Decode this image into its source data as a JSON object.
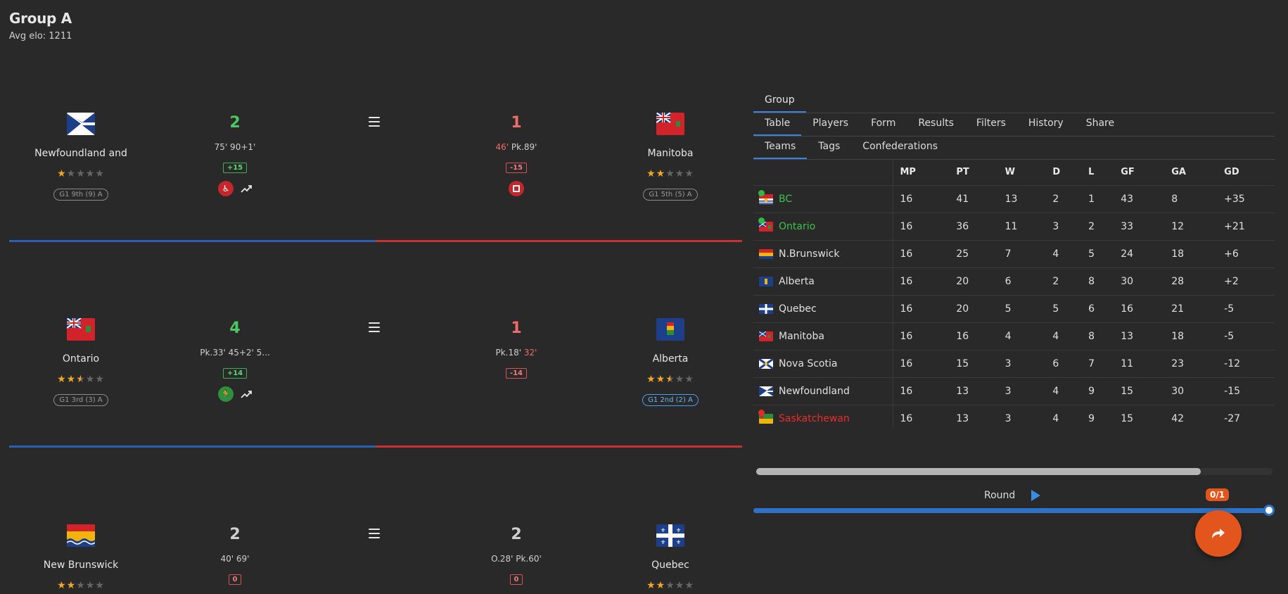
{
  "group": {
    "title": "Group A",
    "avg_elo": "Avg elo: 1211"
  },
  "matches": [
    {
      "home": {
        "name": "Newfoundland and",
        "stars": 1,
        "rank": "G1 9th (9) A"
      },
      "home_score": "2",
      "home_goals": "75' 90+1'",
      "home_delta": "+15",
      "away_score": "1",
      "away_goals_red": "46'",
      "away_goals": "Pk.89'",
      "away_delta": "-15",
      "away": {
        "name": "Manitoba",
        "stars": 2,
        "rank": "G1 5th (5) A"
      }
    },
    {
      "home": {
        "name": "Ontario",
        "stars": 2.5,
        "rank": "G1 3rd (3) A"
      },
      "home_score": "4",
      "home_goals": "Pk.33' 45+2' 5...",
      "home_delta": "+14",
      "away_score": "1",
      "away_goals": "Pk.18'",
      "away_goals_red": "32'",
      "away_delta": "-14",
      "away": {
        "name": "Alberta",
        "stars": 2.5,
        "rank": "G1 2nd (2) A"
      }
    },
    {
      "home": {
        "name": "New Brunswick",
        "stars": 2
      },
      "home_score": "2",
      "home_goals": "40' 69'",
      "home_delta": "0",
      "away_score": "2",
      "away_goals": "O.28' Pk.60'",
      "away_delta": "0",
      "away": {
        "name": "Quebec",
        "stars": 2
      }
    }
  ],
  "panel": {
    "top_tab": "Group",
    "tabs": [
      "Table",
      "Players",
      "Form",
      "Results",
      "Filters",
      "History",
      "Share"
    ],
    "subtabs": [
      "Teams",
      "Tags",
      "Confederations"
    ],
    "columns": [
      "MP",
      "PT",
      "W",
      "D",
      "L",
      "GF",
      "GA",
      "GD"
    ],
    "rows": [
      {
        "team": "BC",
        "status": "promo",
        "mp": "16",
        "pt": "41",
        "w": "13",
        "d": "2",
        "l": "1",
        "gf": "43",
        "ga": "8",
        "gd": "+35"
      },
      {
        "team": "Ontario",
        "status": "promo",
        "mp": "16",
        "pt": "36",
        "w": "11",
        "d": "3",
        "l": "2",
        "gf": "33",
        "ga": "12",
        "gd": "+21"
      },
      {
        "team": "N.Brunswick",
        "status": "",
        "mp": "16",
        "pt": "25",
        "w": "7",
        "d": "4",
        "l": "5",
        "gf": "24",
        "ga": "18",
        "gd": "+6"
      },
      {
        "team": "Alberta",
        "status": "",
        "mp": "16",
        "pt": "20",
        "w": "6",
        "d": "2",
        "l": "8",
        "gf": "30",
        "ga": "28",
        "gd": "+2"
      },
      {
        "team": "Quebec",
        "status": "",
        "mp": "16",
        "pt": "20",
        "w": "5",
        "d": "5",
        "l": "6",
        "gf": "16",
        "ga": "21",
        "gd": "-5"
      },
      {
        "team": "Manitoba",
        "status": "",
        "mp": "16",
        "pt": "16",
        "w": "4",
        "d": "4",
        "l": "8",
        "gf": "13",
        "ga": "18",
        "gd": "-5"
      },
      {
        "team": "Nova Scotia",
        "status": "",
        "mp": "16",
        "pt": "15",
        "w": "3",
        "d": "6",
        "l": "7",
        "gf": "11",
        "ga": "23",
        "gd": "-12"
      },
      {
        "team": "Newfoundland",
        "status": "",
        "mp": "16",
        "pt": "13",
        "w": "3",
        "d": "4",
        "l": "9",
        "gf": "15",
        "ga": "30",
        "gd": "-15"
      },
      {
        "team": "Saskatchewan",
        "status": "releg",
        "mp": "16",
        "pt": "13",
        "w": "3",
        "d": "4",
        "l": "9",
        "gf": "15",
        "ga": "42",
        "gd": "-27"
      }
    ],
    "round_label": "Round",
    "round_badge": "0/1"
  },
  "colors": {
    "accent": "#3a83e0",
    "promo": "#3ec24b",
    "releg": "#ef2a2a",
    "fab": "#e2561d"
  }
}
